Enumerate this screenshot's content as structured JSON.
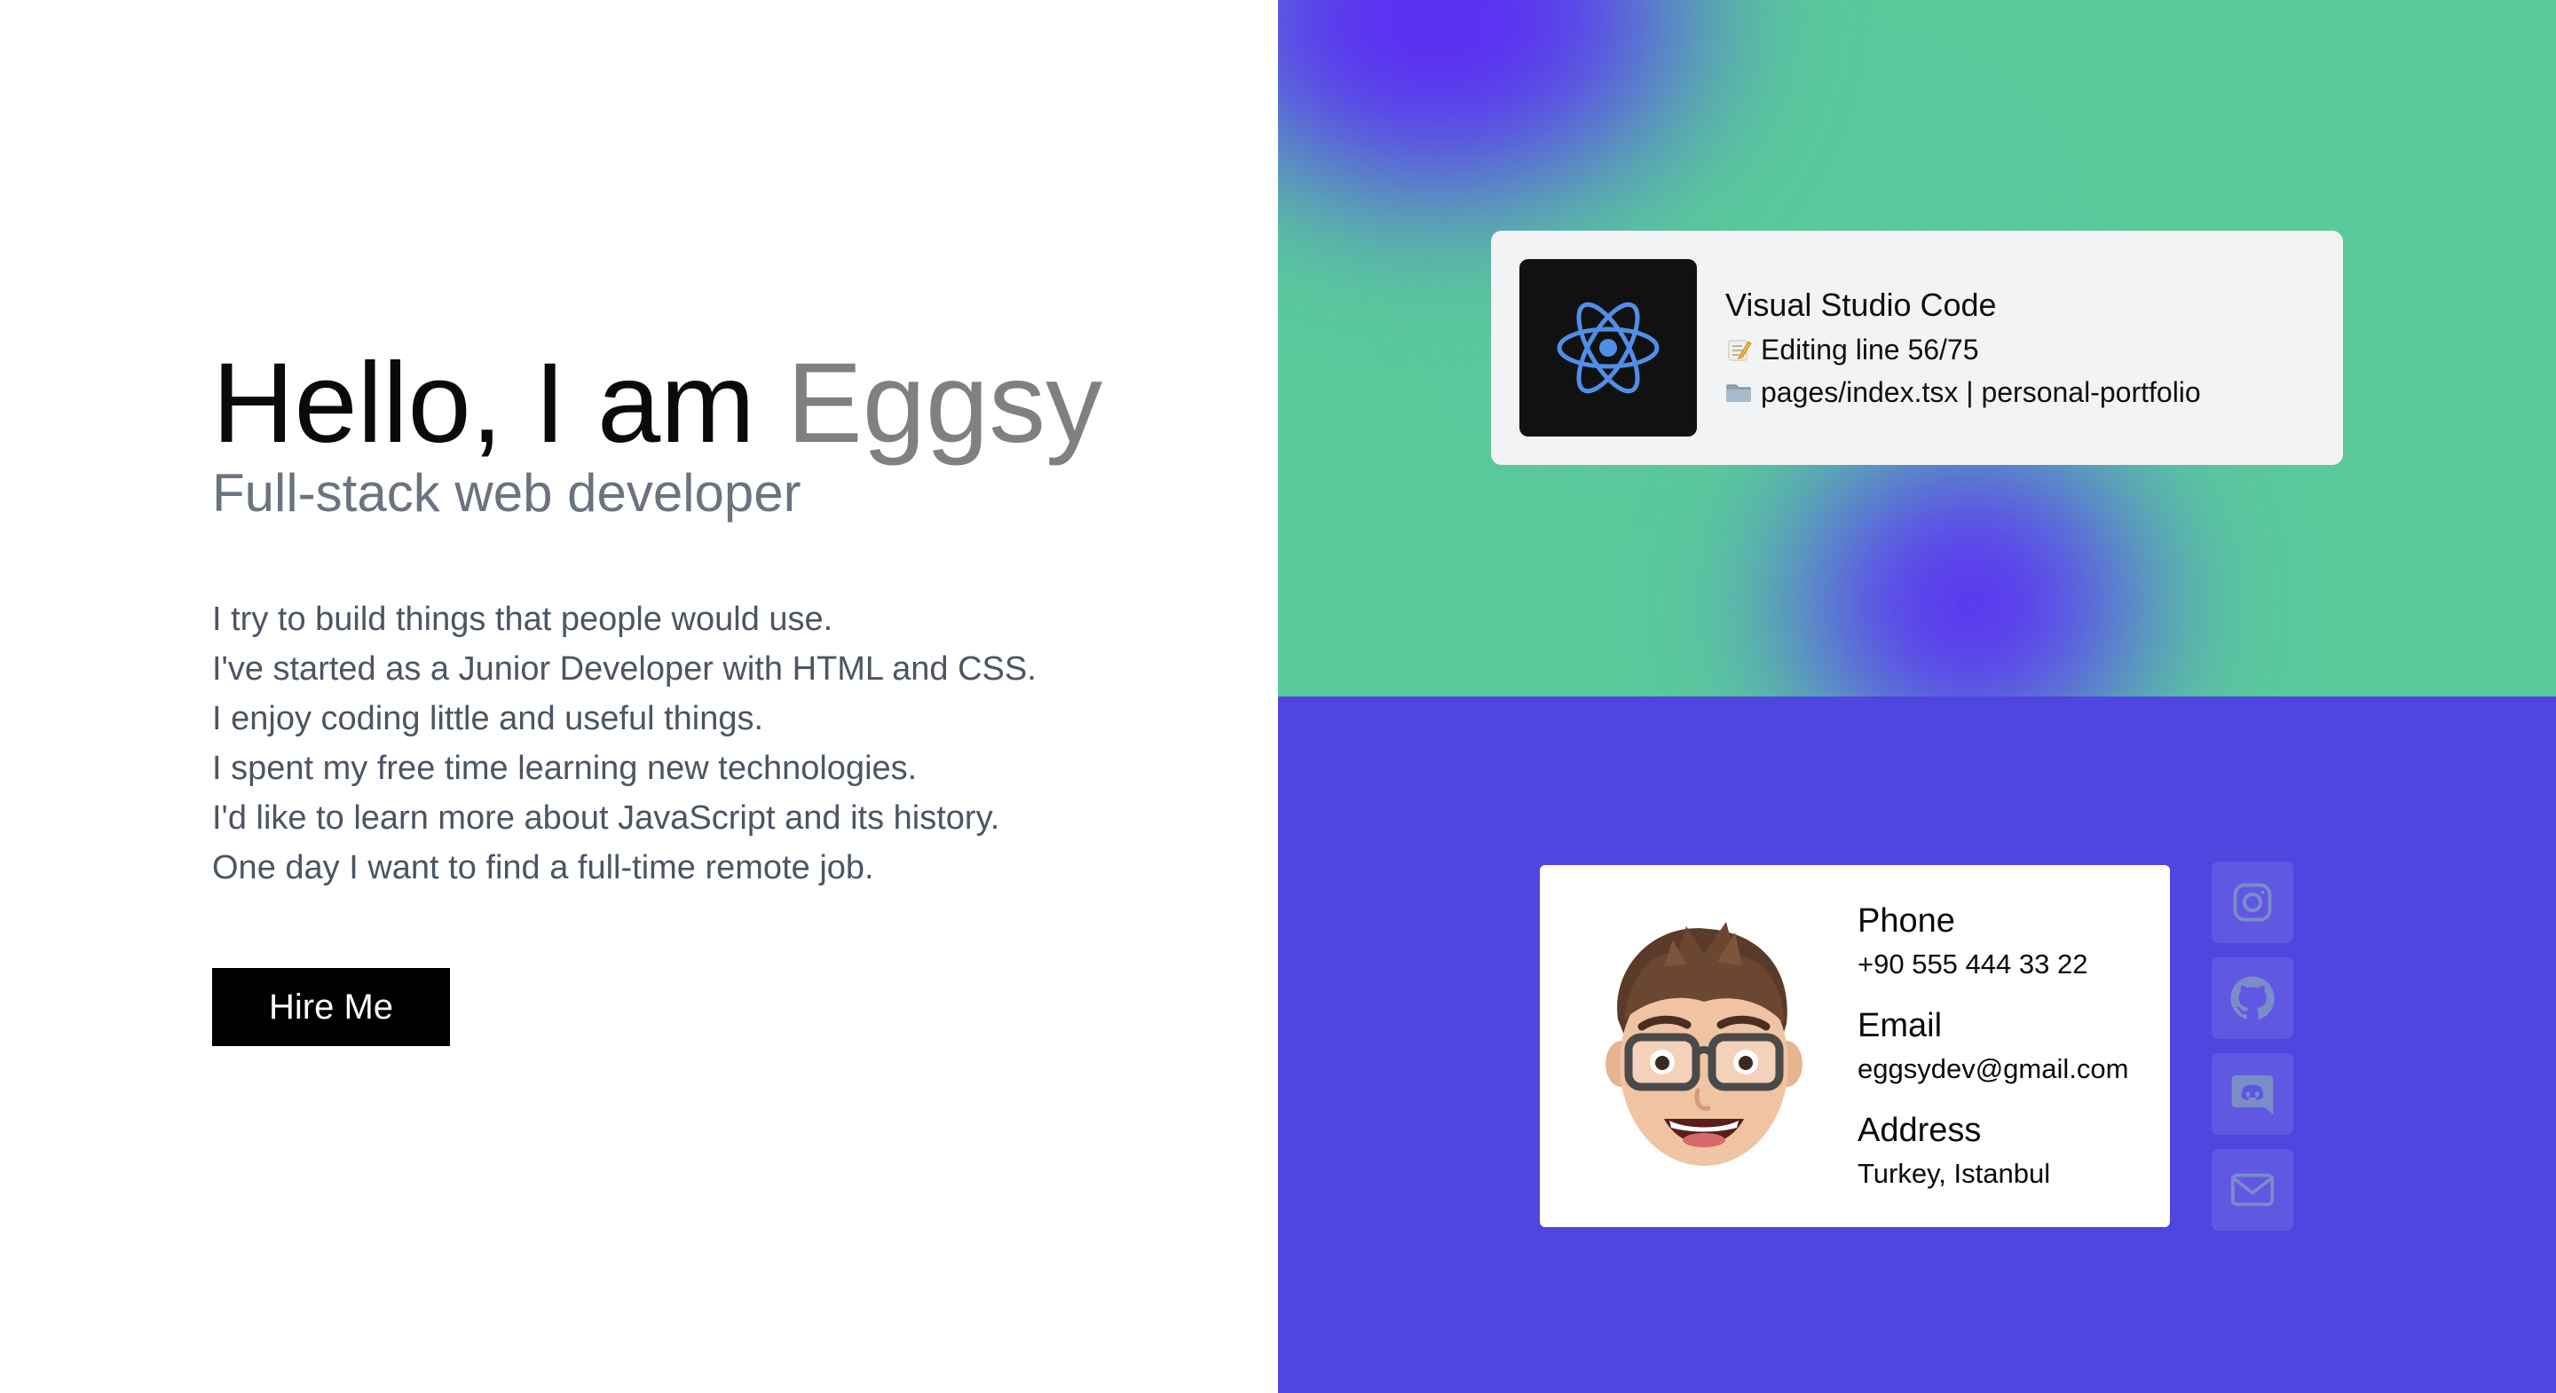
{
  "hero": {
    "greeting": "Hello, I am ",
    "name": "Eggsy",
    "role": "Full-stack web developer",
    "bio": [
      "I try to build things that people would use.",
      "I've started as a Junior Developer with HTML and CSS.",
      "I enjoy coding little and useful things.",
      "I spent my free time learning new technologies.",
      "I'd like to learn more about JavaScript and its history.",
      "One day I want to find a full-time remote job."
    ],
    "cta_label": "Hire Me"
  },
  "activity": {
    "app_name": "Visual Studio Code",
    "app_icon": "react-icon",
    "details": "Editing line 56/75",
    "details_icon": "memo-icon",
    "state": "pages/index.tsx | personal-portfolio",
    "state_icon": "folder-icon"
  },
  "contact": {
    "avatar": "memoji-avatar",
    "phone_label": "Phone",
    "phone_value": "+90 555 444 33 22",
    "email_label": "Email",
    "email_value": "eggsydev@gmail.com",
    "address_label": "Address",
    "address_value": "Turkey, Istanbul"
  },
  "socials": [
    {
      "icon": "instagram-icon"
    },
    {
      "icon": "github-icon"
    },
    {
      "icon": "discord-icon"
    },
    {
      "icon": "mail-icon"
    }
  ],
  "colors": {
    "purple": "#4f46e0",
    "green": "#5ac99c",
    "gradient_violet": "#5a24f4",
    "react_blue": "#4f8fe8",
    "name_gray": "#808080",
    "role_gray": "#6b7280",
    "bio_gray": "#4b5563"
  }
}
